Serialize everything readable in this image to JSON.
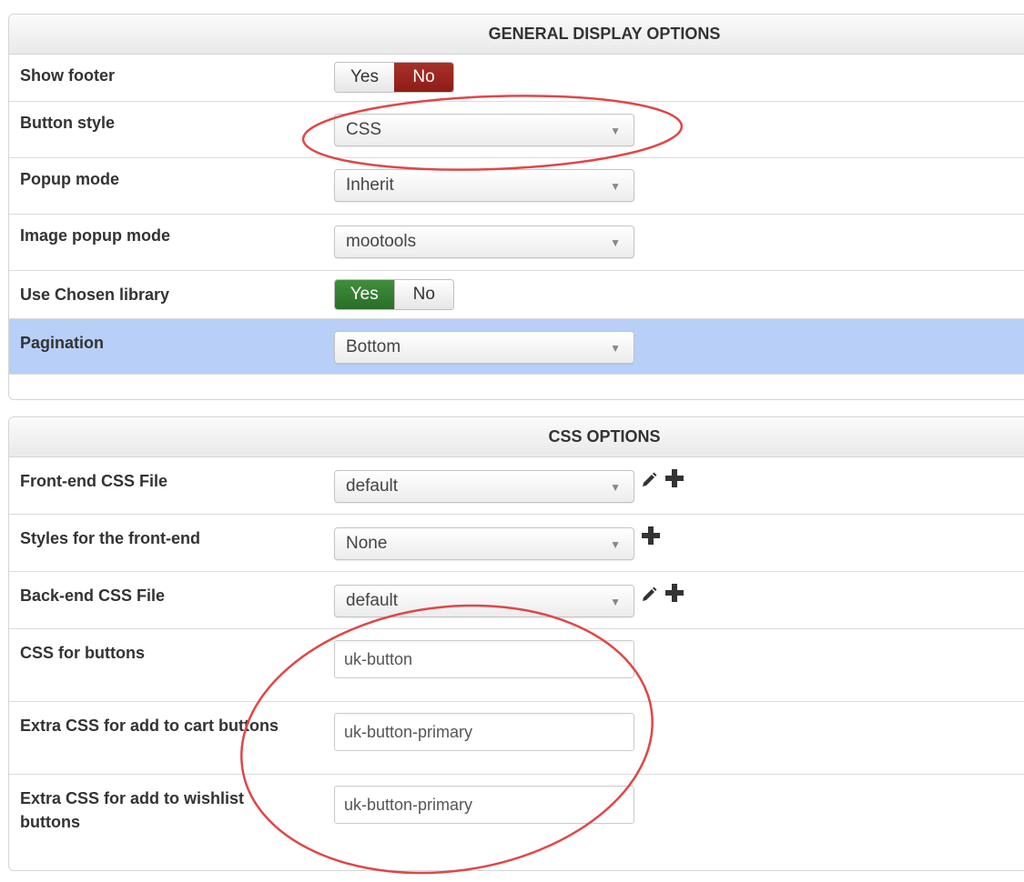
{
  "general_display": {
    "header": "GENERAL DISPLAY OPTIONS",
    "show_footer": {
      "label": "Show footer",
      "yes": "Yes",
      "no": "No",
      "selected": "No"
    },
    "button_style": {
      "label": "Button style",
      "value": "CSS"
    },
    "popup_mode": {
      "label": "Popup mode",
      "value": "Inherit"
    },
    "image_popup_mode": {
      "label": "Image popup mode",
      "value": "mootools"
    },
    "use_chosen": {
      "label": "Use Chosen library",
      "yes": "Yes",
      "no": "No",
      "selected": "Yes"
    },
    "pagination": {
      "label": "Pagination",
      "value": "Bottom"
    }
  },
  "css_options": {
    "header": "CSS OPTIONS",
    "frontend_css": {
      "label": "Front-end CSS File",
      "value": "default"
    },
    "frontend_styles": {
      "label": "Styles for the front-end",
      "value": "None"
    },
    "backend_css": {
      "label": "Back-end CSS File",
      "value": "default"
    },
    "css_buttons": {
      "label": "CSS for buttons",
      "value": "uk-button"
    },
    "extra_css_cart": {
      "label": "Extra CSS for add to cart buttons",
      "value": "uk-button-primary"
    },
    "extra_css_wishlist": {
      "label_line1": "Extra CSS for add to wishlist",
      "label_line2": "buttons",
      "value": "uk-button-primary"
    }
  },
  "icons": {
    "edit": "pencil-icon",
    "add": "plus-icon",
    "caret": "caret-down-icon"
  },
  "colors": {
    "toggle_no_active": "#962520",
    "toggle_yes_active": "#337a31",
    "highlight_row": "#b8d0f7",
    "annotation": "#e04646"
  }
}
